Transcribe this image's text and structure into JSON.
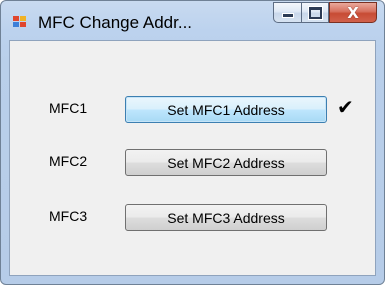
{
  "window": {
    "title": "MFC Change Addr..."
  },
  "title_controls": {
    "minimize": "minimize-icon",
    "maximize": "maximize-icon",
    "close": "close-icon"
  },
  "rows": [
    {
      "label": "MFC1",
      "button": "Set MFC1 Address",
      "status_icon": "checkmark-icon",
      "status_glyph": "✔"
    },
    {
      "label": "MFC2",
      "button": "Set MFC2 Address"
    },
    {
      "label": "MFC3",
      "button": "Set MFC3 Address"
    }
  ]
}
